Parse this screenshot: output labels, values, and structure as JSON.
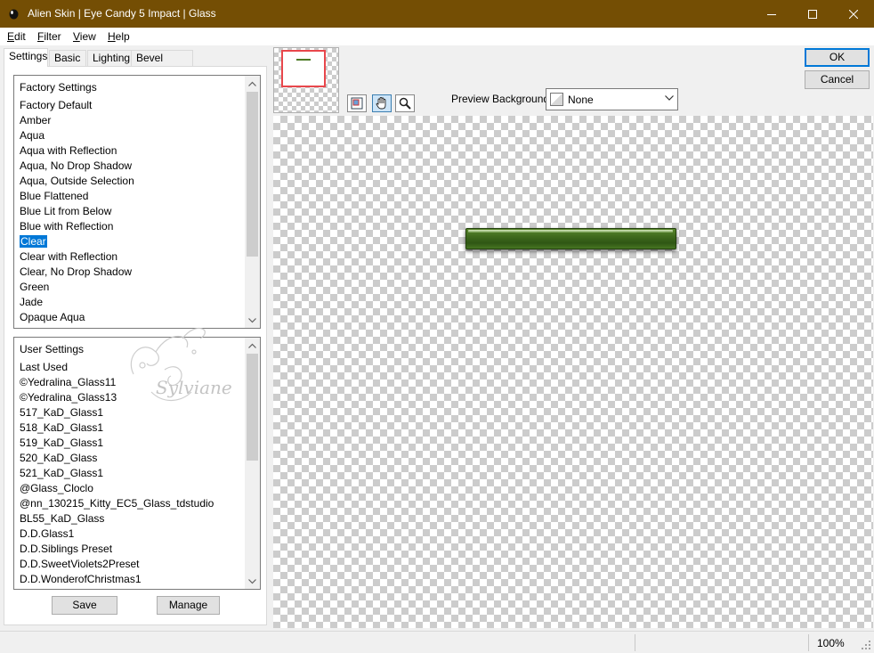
{
  "window": {
    "title": "Alien Skin | Eye Candy 5 Impact | Glass",
    "title_bar_color": "#744e04"
  },
  "menu": [
    {
      "label": "Edit",
      "first": "E",
      "rest": "dit"
    },
    {
      "label": "Filter",
      "first": "F",
      "rest": "ilter"
    },
    {
      "label": "View",
      "first": "V",
      "rest": "iew"
    },
    {
      "label": "Help",
      "first": "H",
      "rest": "elp"
    }
  ],
  "tabs": [
    "Settings",
    "Basic",
    "Lighting",
    "Bevel Profile"
  ],
  "factory": {
    "header": "Factory Settings",
    "items": [
      "Factory Default",
      "Amber",
      "Aqua",
      "Aqua with Reflection",
      "Aqua, No Drop Shadow",
      "Aqua, Outside Selection",
      "Blue Flattened",
      "Blue Lit from Below",
      "Blue with Reflection",
      "Clear",
      "Clear with Reflection",
      "Clear, No Drop Shadow",
      "Green",
      "Jade",
      "Opaque Aqua"
    ],
    "selected": "Clear"
  },
  "user": {
    "header": "User Settings",
    "items": [
      "Last Used",
      "©Yedralina_Glass11",
      "©Yedralina_Glass13",
      "517_KaD_Glass1",
      "518_KaD_Glass1",
      "519_KaD_Glass1",
      "520_KaD_Glass",
      "521_KaD_Glass1",
      "@Glass_Cloclo",
      "@nn_130215_Kitty_EC5_Glass_tdstudio",
      "BL55_KaD_Glass",
      "D.D.Glass1",
      "D.D.Siblings Preset",
      "D.D.SweetViolets2Preset",
      "D.D.WonderofChristmas1"
    ],
    "watermark": "Sylviane"
  },
  "buttons": {
    "save": "Save",
    "manage": "Manage",
    "ok": "OK",
    "cancel": "Cancel"
  },
  "preview": {
    "background_label": "Preview Background:",
    "background_value": "None",
    "effect_color": "#3f6a1d",
    "tools": [
      "navigate-icon",
      "hand-icon",
      "zoom-icon"
    ]
  },
  "status": {
    "zoom": "100%"
  },
  "colors": {
    "selection": "#0078d7",
    "nav_rect": "#e8474c",
    "ok_border": "#0078d7"
  }
}
